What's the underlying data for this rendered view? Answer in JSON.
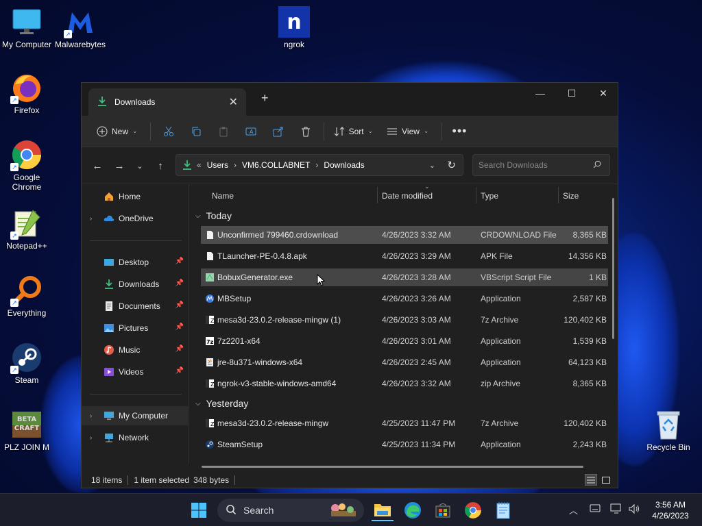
{
  "desktop": {
    "icons": [
      {
        "label": "My Computer"
      },
      {
        "label": "Malwarebytes"
      },
      {
        "label": "ngrok"
      },
      {
        "label": "Firefox"
      },
      {
        "label": "Google Chrome"
      },
      {
        "label": "Notepad++"
      },
      {
        "label": "Everything"
      },
      {
        "label": "Steam"
      },
      {
        "label": "PLZ JOIN M"
      },
      {
        "label": "Recycle Bin"
      }
    ]
  },
  "window": {
    "tab_title": "Downloads",
    "toolbar": {
      "new_label": "New",
      "sort_label": "Sort",
      "view_label": "View"
    },
    "address": {
      "crumbs": [
        "Users",
        "VM6.COLLABNET",
        "Downloads"
      ],
      "overflow": "«",
      "search_placeholder": "Search Downloads"
    },
    "sidebar": {
      "items": [
        {
          "label": "Home"
        },
        {
          "label": "OneDrive"
        },
        {
          "label": "Desktop"
        },
        {
          "label": "Downloads"
        },
        {
          "label": "Documents"
        },
        {
          "label": "Pictures"
        },
        {
          "label": "Music"
        },
        {
          "label": "Videos"
        },
        {
          "label": "My Computer"
        },
        {
          "label": "Network"
        }
      ]
    },
    "columns": {
      "name": "Name",
      "date": "Date modified",
      "type": "Type",
      "size": "Size"
    },
    "groups": [
      {
        "label": "Today",
        "files": [
          {
            "name": "Unconfirmed 799460.crdownload",
            "date": "4/26/2023 3:32 AM",
            "type": "CRDOWNLOAD File",
            "size": "8,365 KB"
          },
          {
            "name": "TLauncher-PE-0.4.8.apk",
            "date": "4/26/2023 3:29 AM",
            "type": "APK File",
            "size": "14,356 KB"
          },
          {
            "name": "BobuxGenerator.exe",
            "date": "4/26/2023 3:28 AM",
            "type": "VBScript Script File",
            "size": "1 KB"
          },
          {
            "name": "MBSetup",
            "date": "4/26/2023 3:26 AM",
            "type": "Application",
            "size": "2,587 KB"
          },
          {
            "name": "mesa3d-23.0.2-release-mingw (1)",
            "date": "4/26/2023 3:03 AM",
            "type": "7z Archive",
            "size": "120,402 KB"
          },
          {
            "name": "7z2201-x64",
            "date": "4/26/2023 3:01 AM",
            "type": "Application",
            "size": "1,539 KB"
          },
          {
            "name": "jre-8u371-windows-x64",
            "date": "4/26/2023 2:45 AM",
            "type": "Application",
            "size": "64,123 KB"
          },
          {
            "name": "ngrok-v3-stable-windows-amd64",
            "date": "4/26/2023 3:32 AM",
            "type": "zip Archive",
            "size": "8,365 KB"
          }
        ]
      },
      {
        "label": "Yesterday",
        "files": [
          {
            "name": "mesa3d-23.0.2-release-mingw",
            "date": "4/25/2023 11:47 PM",
            "type": "7z Archive",
            "size": "120,402 KB"
          },
          {
            "name": "SteamSetup",
            "date": "4/25/2023 11:34 PM",
            "type": "Application",
            "size": "2,243 KB"
          }
        ]
      }
    ],
    "status": {
      "items": "18 items",
      "selected": "1 item selected",
      "bytes": "348 bytes"
    }
  },
  "taskbar": {
    "search_label": "Search",
    "time": "3:56 AM",
    "date": "4/26/2023"
  }
}
